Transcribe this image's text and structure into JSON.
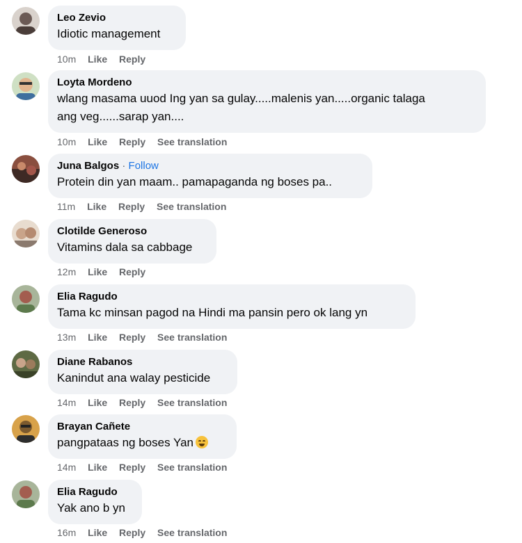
{
  "comments": [
    {
      "author": "Leo Zevio",
      "follow": "",
      "lines": [
        "Idiotic management"
      ],
      "time": "10m",
      "like": "Like",
      "reply": "Reply",
      "translate": "",
      "avatar_color": "#6b5a55"
    },
    {
      "author": "Loyta Mordeno",
      "follow": "",
      "lines": [
        "wlang masama uuod Ing yan sa gulay.....malenis yan.....organic talaga",
        "ang veg......sarap yan...."
      ],
      "time": "10m",
      "like": "Like",
      "reply": "Reply",
      "translate": "See translation",
      "avatar_color": "#8fb07a"
    },
    {
      "author": "Juna Balgos",
      "follow": "Follow",
      "lines": [
        "Protein din yan maam.. pamapaganda ng boses pa.."
      ],
      "time": "11m",
      "like": "Like",
      "reply": "Reply",
      "translate": "See translation",
      "avatar_color": "#8a4f3f"
    },
    {
      "author": "Clotilde Generoso",
      "follow": "",
      "lines": [
        "Vitamins dala sa cabbage"
      ],
      "time": "12m",
      "like": "Like",
      "reply": "Reply",
      "translate": "",
      "avatar_color": "#b79f8d"
    },
    {
      "author": "Elia Ragudo",
      "follow": "",
      "lines": [
        "Tama kc minsan pagod na Hindi ma pansin pero ok lang yn"
      ],
      "time": "13m",
      "like": "Like",
      "reply": "Reply",
      "translate": "See translation",
      "avatar_color": "#a35d4f"
    },
    {
      "author": "Diane Rabanos",
      "follow": "",
      "lines": [
        "Kanindut ana walay pesticide"
      ],
      "time": "14m",
      "like": "Like",
      "reply": "Reply",
      "translate": "See translation",
      "avatar_color": "#5e6a44"
    },
    {
      "author": "Brayan Cañete",
      "follow": "",
      "lines": [
        "pangpataas ng boses Yan"
      ],
      "emoji": "laughing-face",
      "time": "14m",
      "like": "Like",
      "reply": "Reply",
      "translate": "See translation",
      "avatar_color": "#7c5a2e"
    },
    {
      "author": "Elia Ragudo",
      "follow": "",
      "lines": [
        "Yak ano b yn"
      ],
      "time": "16m",
      "like": "Like",
      "reply": "Reply",
      "translate": "See translation",
      "avatar_color": "#a35d4f"
    }
  ]
}
